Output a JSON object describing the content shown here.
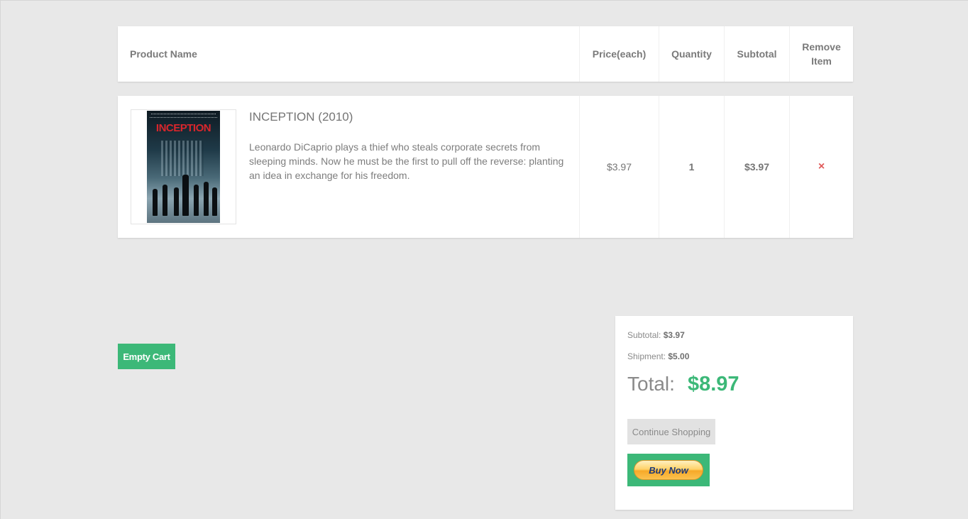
{
  "table_header": {
    "product_name": "Product Name",
    "price_each": "Price(each)",
    "quantity": "Quantity",
    "subtotal": "Subtotal",
    "remove_item": "Remove Item"
  },
  "cart_items": [
    {
      "poster_title": "INCEPTION",
      "title": "INCEPTION (2010)",
      "description": "Leonardo DiCaprio plays a thief who steals corporate secrets from sleeping minds. Now he must be the first to pull off the reverse: planting an idea in exchange for his freedom.",
      "price": "$3.97",
      "quantity": "1",
      "subtotal": "$3.97",
      "remove_icon": "×"
    }
  ],
  "actions": {
    "empty_cart": "Empty Cart",
    "continue_shopping": "Continue Shopping",
    "buy_now": "Buy Now"
  },
  "summary": {
    "subtotal_label": "Subtotal:",
    "subtotal_value": "$3.97",
    "shipment_label": "Shipment:",
    "shipment_value": "$5.00",
    "total_label": "Total:",
    "total_value": "$8.97"
  },
  "colors": {
    "background": "#e8e8e8",
    "accent_green": "#3cb878",
    "remove_red": "#e05a5a"
  },
  "icons": {
    "remove": "close-icon"
  }
}
